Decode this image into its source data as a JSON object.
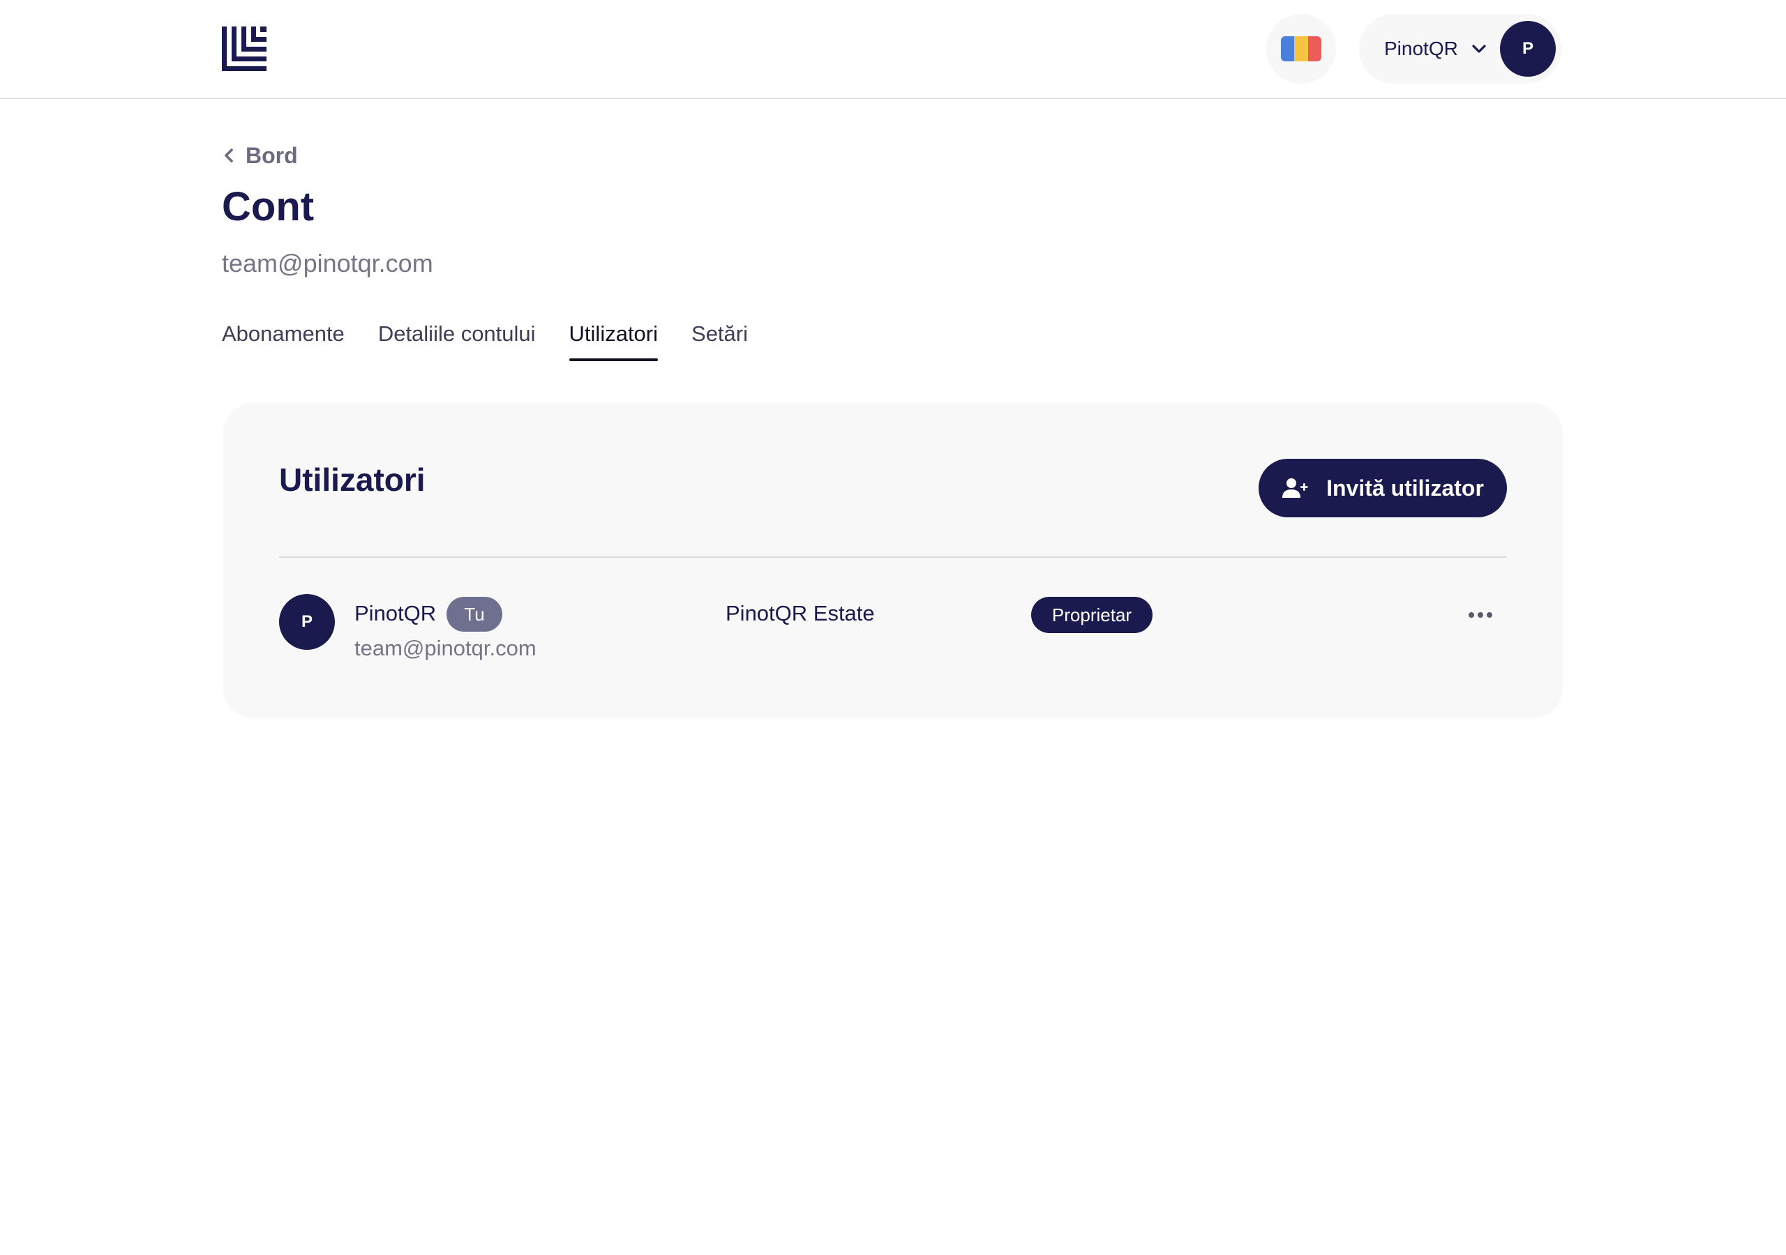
{
  "header": {
    "logo_icon": "brand-logo-icon",
    "language_flag_colors": [
      "#4a7fdc",
      "#f5c542",
      "#ef5b5b"
    ],
    "account_name": "PinotQR",
    "avatar_initial": "P"
  },
  "breadcrumb": {
    "label": "Bord",
    "icon": "chevron-left-icon"
  },
  "page": {
    "title": "Cont",
    "email": "team@pinotqr.com"
  },
  "tabs": [
    {
      "label": "Abonamente",
      "active": false
    },
    {
      "label": "Detaliile contului",
      "active": false
    },
    {
      "label": "Utilizatori",
      "active": true
    },
    {
      "label": "Setări",
      "active": false
    }
  ],
  "users_card": {
    "title": "Utilizatori",
    "invite_label": "Invită utilizator",
    "invite_icon": "user-plus-icon",
    "rows": [
      {
        "avatar_initial": "P",
        "name": "PinotQR",
        "self_badge": "Tu",
        "email": "team@pinotqr.com",
        "organization": "PinotQR Estate",
        "role": "Proprietar"
      }
    ]
  },
  "colors": {
    "brand_navy": "#1a1a4e",
    "muted_text": "#757585",
    "card_background": "#f8f8f8"
  }
}
